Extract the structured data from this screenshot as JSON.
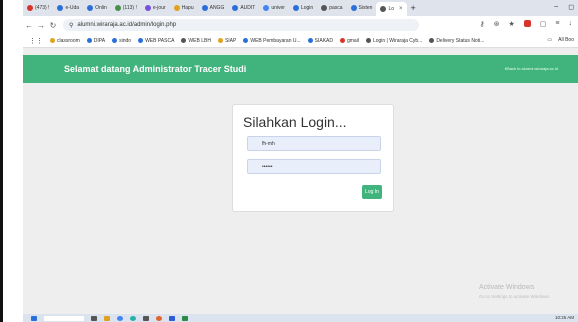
{
  "browser": {
    "tabs": [
      {
        "label": "(473) !",
        "color": "#d9342b"
      },
      {
        "label": "e-Uda",
        "color": "#2b6fd9"
      },
      {
        "label": "Onlin",
        "color": "#2b6fd9"
      },
      {
        "label": "(113) !",
        "color": "#4a8f4a"
      },
      {
        "label": "e-jour",
        "color": "#7a4fd9"
      },
      {
        "label": "Hapu",
        "color": "#e0a020"
      },
      {
        "label": "ANGG",
        "color": "#2b6fd9"
      },
      {
        "label": "AUDIT",
        "color": "#2b6fd9"
      },
      {
        "label": "univer",
        "color": "#4285f4"
      },
      {
        "label": "Login",
        "color": "#2b6fd9"
      },
      {
        "label": "pasca",
        "color": "#555555"
      },
      {
        "label": "Sisten",
        "color": "#2b6fd9"
      },
      {
        "label": "Lo",
        "color": "#555555",
        "active": true
      }
    ],
    "new_tab": "+",
    "url": "alumni.wiraraja.ac.id/admin/login.php",
    "bookmarks": [
      "classroom",
      "DIPA",
      "sindo",
      "WEB PASCA",
      "WEB LBH",
      "SIAP",
      "WEB Pembayaran U...",
      "SIAKAD",
      "gmail",
      "Login | Wiraraja Cyb...",
      "Delivery Status Noti..."
    ],
    "all_bookmarks": "All Boo"
  },
  "site": {
    "title": "Selamat datang Administrator Tracer Studi",
    "link": "€Back to alumni.wiraraja.ac.id",
    "accent": "#41b37c"
  },
  "login": {
    "heading": "Silahkan Login...",
    "username_value": "fh-mh",
    "password_value": "••••••",
    "button": "Log In"
  },
  "watermark": {
    "title": "Activate Windows",
    "subtitle": "Go to Settings to activate Windows."
  },
  "taskbar": {
    "time": "10:25 AM"
  }
}
